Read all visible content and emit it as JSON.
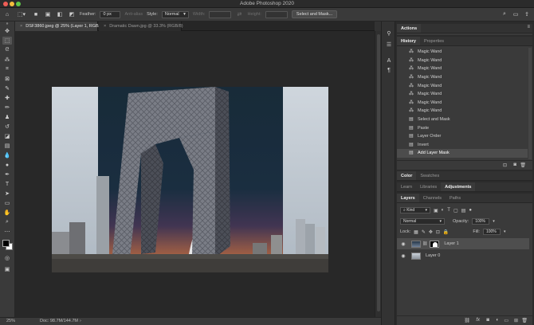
{
  "app": {
    "title": "Adobe Photoshop 2020"
  },
  "colors": {
    "accent": "#3e7fd8",
    "panel_bg": "#3a3a3a",
    "canvas_bg": "#282828",
    "selected_row": "#4c4c4c"
  },
  "options_bar": {
    "feather_label": "Feather:",
    "feather_value": "0 px",
    "anti_alias_label": "Anti-alias",
    "style_label": "Style:",
    "style_value": "Normal",
    "width_label": "Width:",
    "height_label": "Height:",
    "select_mask_label": "Select and Mask...",
    "icons": [
      "home-icon",
      "marquee-options-icon",
      "new-selection-icon",
      "add-selection-icon",
      "subtract-selection-icon",
      "intersect-selection-icon",
      "search-icon",
      "workspace-icon",
      "share-icon"
    ]
  },
  "tabs": [
    {
      "label": "DSF3860.jpeg @ 25% (Layer 1, RGB/8) *",
      "active": true
    },
    {
      "label": "Dramatic Dawn.jpg @ 33.3% (RGB/8)",
      "active": false
    }
  ],
  "status": {
    "zoom": "25%",
    "doc": "Doc: 98.7M/144.7M"
  },
  "actions_panel": {
    "tab": "Actions"
  },
  "history_panel": {
    "tabs": [
      "History",
      "Properties"
    ],
    "items": [
      {
        "label": "Magic Wand",
        "icon": "magic-wand-icon"
      },
      {
        "label": "Magic Wand",
        "icon": "magic-wand-icon"
      },
      {
        "label": "Magic Wand",
        "icon": "magic-wand-icon"
      },
      {
        "label": "Magic Wand",
        "icon": "magic-wand-icon"
      },
      {
        "label": "Magic Wand",
        "icon": "magic-wand-icon"
      },
      {
        "label": "Magic Wand",
        "icon": "magic-wand-icon"
      },
      {
        "label": "Magic Wand",
        "icon": "magic-wand-icon"
      },
      {
        "label": "Magic Wand",
        "icon": "magic-wand-icon"
      },
      {
        "label": "Select and Mask",
        "icon": "document-icon"
      },
      {
        "label": "Paste",
        "icon": "document-icon"
      },
      {
        "label": "Layer Order",
        "icon": "document-icon"
      },
      {
        "label": "Invert",
        "icon": "document-icon"
      },
      {
        "label": "Add Layer Mask",
        "icon": "document-icon",
        "selected": true
      }
    ]
  },
  "color_panel": {
    "tabs": [
      "Color",
      "Swatches"
    ]
  },
  "adjust_panel": {
    "tabs": [
      "Learn",
      "Libraries",
      "Adjustments"
    ]
  },
  "layers_panel": {
    "tabs": [
      "Layers",
      "Channels",
      "Paths"
    ],
    "kind": "Kind",
    "blend_mode": "Normal",
    "opacity_label": "Opacity:",
    "opacity_value": "100%",
    "lock_label": "Lock:",
    "fill_label": "Fill:",
    "fill_value": "100%",
    "layers": [
      {
        "name": "Layer 1",
        "selected": true,
        "has_mask": true
      },
      {
        "name": "Layer 0",
        "selected": false,
        "has_mask": false
      }
    ]
  }
}
